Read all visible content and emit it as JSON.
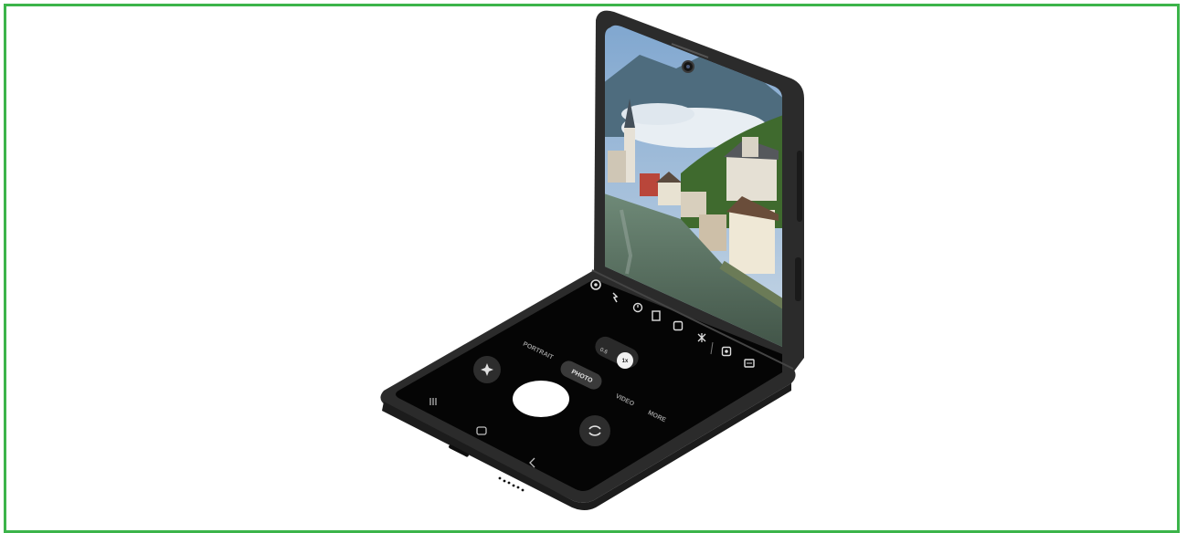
{
  "colors": {
    "frame_border": "#3cb44a",
    "phone_body": "#2b2b2b",
    "phone_edge": "#3a3a3a",
    "screen_bg": "#050505",
    "sky": "#8fb3d9",
    "cloud": "#e8eef3",
    "mountain": "#4e6c7e",
    "forest": "#3f6a2e",
    "lake": "#556a5a",
    "shutter": "#ffffff"
  },
  "camera": {
    "modes": {
      "portrait": "PORTRAIT",
      "photo": "PHOTO",
      "video": "VIDEO",
      "more": "MORE"
    },
    "zoom": {
      "wide": "0.6",
      "standard": "1x"
    }
  },
  "icons": {
    "settings": "gear-icon",
    "flash": "flash-off-icon",
    "timer": "timer-icon",
    "ratio": "aspect-ratio-icon",
    "motion": "motion-photo-icon",
    "filters": "filters-icon",
    "gallery": "gallery-thumbnail-icon",
    "bixby": "bixby-vision-icon",
    "effects": "effects-icon",
    "switch": "switch-camera-icon",
    "recent": "recent-apps-icon",
    "home": "home-icon",
    "back": "back-icon"
  }
}
